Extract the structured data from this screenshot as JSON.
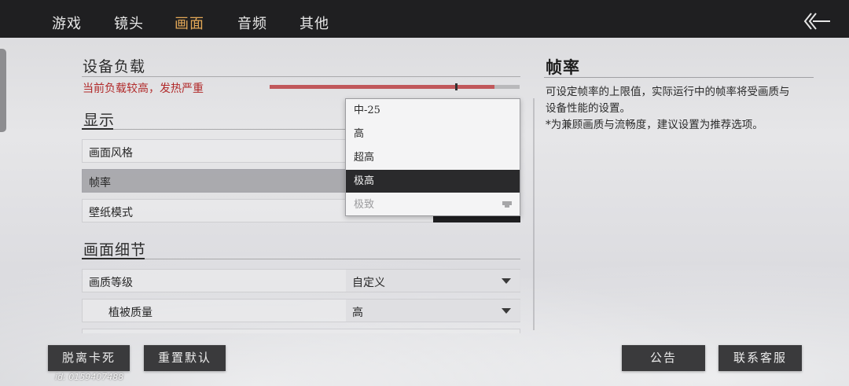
{
  "tabs": [
    {
      "label": "游戏",
      "active": false
    },
    {
      "label": "镜头",
      "active": false
    },
    {
      "label": "画面",
      "active": true
    },
    {
      "label": "音频",
      "active": false
    },
    {
      "label": "其他",
      "active": false
    }
  ],
  "device_load": {
    "title": "设备负载",
    "warning": "当前负载较高，发热严重",
    "load_level": 0.9,
    "warning_color": "#b12a2a"
  },
  "display": {
    "title": "显示",
    "rows": [
      {
        "label": "画面风格"
      },
      {
        "label": "帧率"
      },
      {
        "label": "壁纸模式"
      }
    ]
  },
  "framerate_dropdown": {
    "options": [
      {
        "label": "中-25",
        "state": "normal"
      },
      {
        "label": "高",
        "state": "normal"
      },
      {
        "label": "超高",
        "state": "normal"
      },
      {
        "label": "极高",
        "state": "selected"
      },
      {
        "label": "极致",
        "state": "locked"
      }
    ]
  },
  "detail": {
    "title": "画面细节",
    "rows": [
      {
        "label": "画质等级",
        "value": "自定义"
      },
      {
        "label": "植被质量",
        "value": "高"
      }
    ]
  },
  "info": {
    "title": "帧率",
    "line1": "可设定帧率的上限值，实际运行中的帧率将受画质与",
    "line2": "设备性能的设置。",
    "line3": "*为兼顾画质与流畅度，建议设置为推荐选项。"
  },
  "buttons": {
    "unstuck": "脱离卡死",
    "reset": "重置默认",
    "notice": "公告",
    "support": "联系客服"
  },
  "user_id": "id: 0159407488",
  "accent_color": "#e2a757"
}
